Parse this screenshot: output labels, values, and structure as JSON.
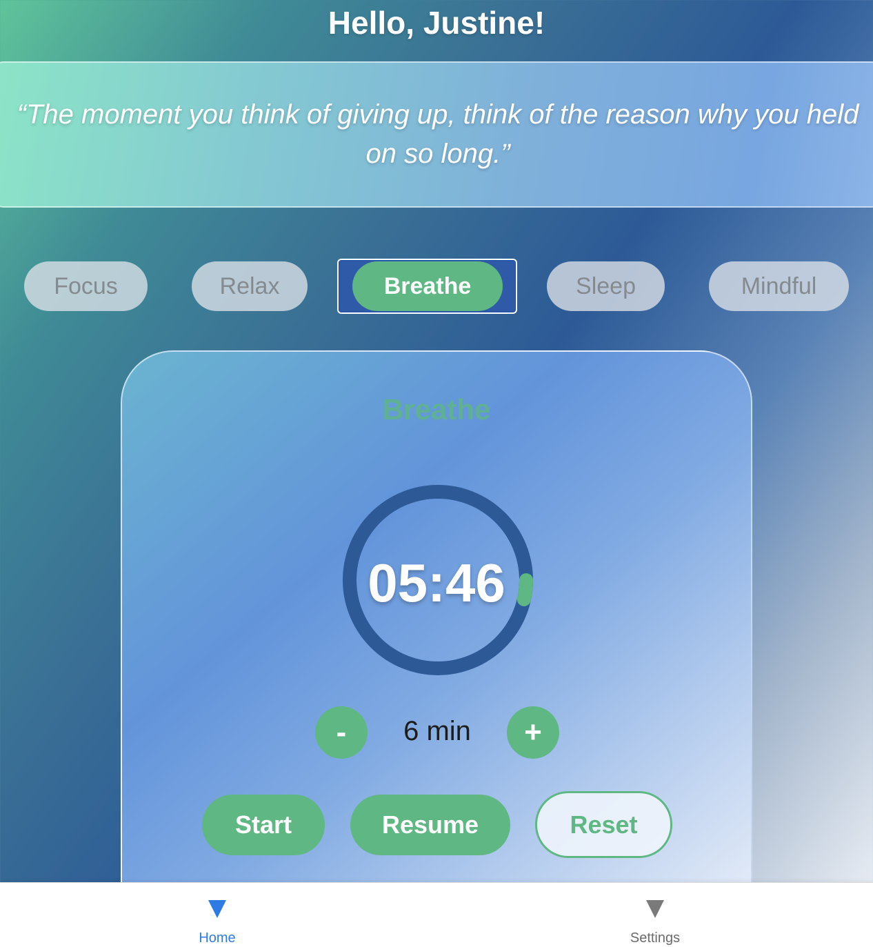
{
  "greeting": "Hello, Justine!",
  "quote": "“The moment you think of giving up, think of the reason why you held on so long.”",
  "modes": {
    "items": [
      {
        "label": "Focus"
      },
      {
        "label": "Relax"
      },
      {
        "label": "Breathe"
      },
      {
        "label": "Sleep"
      },
      {
        "label": "Mindful"
      }
    ],
    "selected": "Breathe"
  },
  "timer": {
    "title": "Breathe",
    "time_remaining": "05:46",
    "progress_fraction": 0.96,
    "duration_label": "6 min",
    "minus_label": "-",
    "plus_label": "+",
    "start_label": "Start",
    "resume_label": "Resume",
    "reset_label": "Reset"
  },
  "nav": {
    "home_label": "Home",
    "home_icon": "triangle-down-icon",
    "settings_label": "Settings",
    "settings_icon": "triangle-down-icon"
  },
  "colors": {
    "accent_green": "#5fb784",
    "ring_dark": "#2d5a96",
    "nav_active": "#2f7be6"
  }
}
